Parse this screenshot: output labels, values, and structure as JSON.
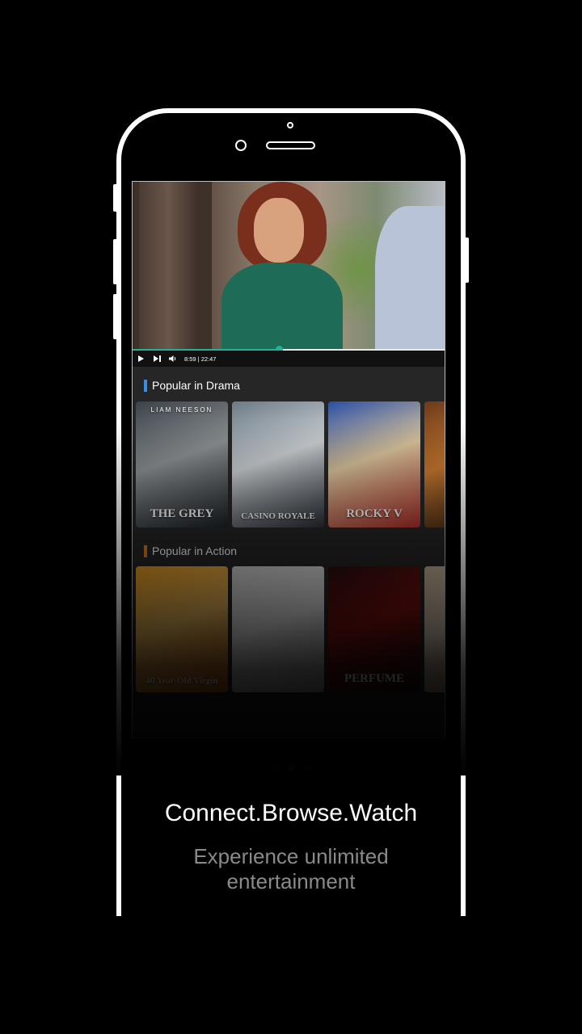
{
  "player": {
    "time_text": "8:59 | 22:47",
    "progress": 0.47,
    "play_icon": "play-icon",
    "next_icon": "skip-next-icon",
    "volume_icon": "volume-icon"
  },
  "sections": [
    {
      "title": "Popular in Drama",
      "accent": "#3a8ee6",
      "posters": [
        {
          "title": "THE GREY",
          "top_text": "LIAM NEESON",
          "colors": [
            "#3a4148",
            "#8a8f92",
            "#1c2126"
          ]
        },
        {
          "title": "CASINO ROYALE",
          "top_text": "",
          "colors": [
            "#6b7a86",
            "#c9ced2",
            "#2a2f36"
          ]
        },
        {
          "title": "ROCKY V",
          "top_text": "",
          "colors": [
            "#2a4fa6",
            "#d8c39a",
            "#b0302a"
          ]
        },
        {
          "title": "",
          "top_text": "",
          "colors": [
            "#6b3a1a",
            "#c9782e",
            "#2b1a10"
          ]
        }
      ]
    },
    {
      "title": "Popular in Action",
      "accent": "#e07a1f",
      "posters": [
        {
          "title": "40 Year-Old Virgin",
          "top_text": "",
          "colors": [
            "#f0a020",
            "#f5c060",
            "#c06010"
          ]
        },
        {
          "title": "",
          "top_text": "",
          "colors": [
            "#d8d8d8",
            "#f2f2f2",
            "#9a9a9a"
          ]
        },
        {
          "title": "PERFUME",
          "top_text": "",
          "colors": [
            "#2a0f10",
            "#8a1010",
            "#1a0a0a"
          ]
        },
        {
          "title": "",
          "top_text": "",
          "colors": [
            "#c9b39a",
            "#e8d6c0",
            "#8a7660"
          ]
        }
      ]
    }
  ],
  "pager": {
    "count": 3,
    "active_index": 1
  },
  "headline": "Connect.Browse.Watch",
  "subline": "Experience unlimited entertainment"
}
